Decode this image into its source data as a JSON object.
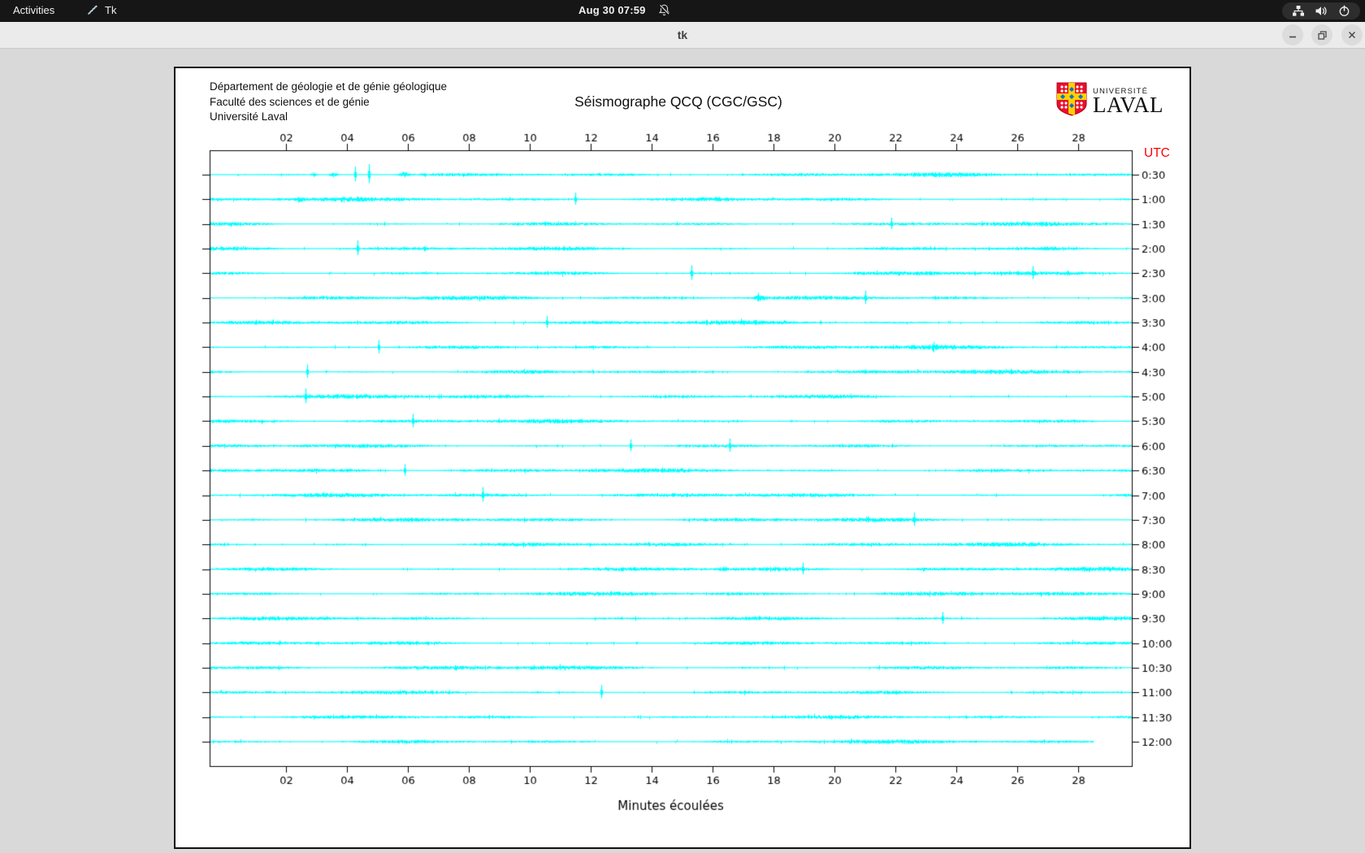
{
  "topbar": {
    "activities_label": "Activities",
    "app_label": "Tk",
    "clock": "Aug 30 07:59"
  },
  "titlebar": {
    "title": "tk"
  },
  "header": {
    "line1": "Département de géologie et de génie géologique",
    "line2": "Faculté des sciences et de génie",
    "line3": "Université Laval"
  },
  "logo": {
    "small": "UNIVERSITÉ",
    "large": "LAVAL"
  },
  "chart_data": {
    "type": "line",
    "title": "Séismographe QCQ (CGC/GSC)",
    "xlabel": "Minutes écoulées",
    "right_axis_label": "UTC",
    "right_axis_color": "#fb0007",
    "trace_color": "#00ffff",
    "x_ticks": [
      "02",
      "04",
      "06",
      "08",
      "10",
      "12",
      "14",
      "16",
      "18",
      "20",
      "22",
      "24",
      "26",
      "28"
    ],
    "x_tick_minutes": [
      2,
      4,
      6,
      8,
      10,
      12,
      14,
      16,
      18,
      20,
      22,
      24,
      26,
      28
    ],
    "x_range_minutes": [
      -0.5,
      29.76
    ],
    "rows": [
      {
        "label": "0:30",
        "spikes": [
          {
            "m": 4.27,
            "a": 10
          },
          {
            "m": 4.72,
            "a": 13
          }
        ],
        "bursts": [
          {
            "m": 2.9,
            "w": 0.3,
            "a": 2.5
          },
          {
            "m": 3.55,
            "w": 0.45,
            "a": 3
          },
          {
            "m": 5.85,
            "w": 0.45,
            "a": 3.2
          }
        ]
      },
      {
        "label": "1:00",
        "spikes": [
          {
            "m": 11.5,
            "a": 8
          }
        ],
        "bursts": [
          {
            "m": 2.45,
            "w": 0.35,
            "a": 3
          },
          {
            "m": 16.15,
            "w": 0.3,
            "a": 2.5
          }
        ]
      },
      {
        "label": "1:30",
        "spikes": [
          {
            "m": 21.87,
            "a": 8
          }
        ],
        "bursts": []
      },
      {
        "label": "2:00",
        "spikes": [
          {
            "m": 4.35,
            "a": 10
          }
        ],
        "bursts": []
      },
      {
        "label": "2:30",
        "spikes": [
          {
            "m": 15.3,
            "a": 10
          },
          {
            "m": 26.5,
            "a": 9
          }
        ],
        "bursts": []
      },
      {
        "label": "3:00",
        "spikes": [
          {
            "m": 21.0,
            "a": 9
          }
        ],
        "bursts": [
          {
            "m": 17.55,
            "w": 0.55,
            "a": 4
          }
        ]
      },
      {
        "label": "3:30",
        "spikes": [
          {
            "m": 10.56,
            "a": 8
          }
        ],
        "bursts": []
      },
      {
        "label": "4:00",
        "spikes": [
          {
            "m": 5.05,
            "a": 9
          }
        ],
        "bursts": [
          {
            "m": 23.25,
            "w": 0.35,
            "a": 4
          }
        ]
      },
      {
        "label": "4:30",
        "spikes": [
          {
            "m": 2.7,
            "a": 9
          }
        ],
        "bursts": []
      },
      {
        "label": "5:00",
        "spikes": [
          {
            "m": 2.65,
            "a": 10
          }
        ],
        "bursts": []
      },
      {
        "label": "5:30",
        "spikes": [
          {
            "m": 6.16,
            "a": 9
          }
        ],
        "bursts": []
      },
      {
        "label": "6:00",
        "spikes": [
          {
            "m": 13.3,
            "a": 8
          },
          {
            "m": 16.56,
            "a": 9
          }
        ],
        "bursts": []
      },
      {
        "label": "6:30",
        "spikes": [
          {
            "m": 5.89,
            "a": 8
          }
        ],
        "bursts": []
      },
      {
        "label": "7:00",
        "spikes": [
          {
            "m": 8.45,
            "a": 10
          }
        ],
        "bursts": []
      },
      {
        "label": "7:30",
        "spikes": [
          {
            "m": 22.6,
            "a": 9
          }
        ],
        "bursts": []
      },
      {
        "label": "8:00",
        "spikes": [],
        "bursts": []
      },
      {
        "label": "8:30",
        "spikes": [
          {
            "m": 18.95,
            "a": 8
          }
        ],
        "bursts": [
          {
            "m": 16.4,
            "w": 0.25,
            "a": 2.5
          },
          {
            "m": 22.9,
            "w": 0.2,
            "a": 2
          }
        ]
      },
      {
        "label": "9:00",
        "spikes": [],
        "bursts": []
      },
      {
        "label": "9:30",
        "spikes": [
          {
            "m": 23.55,
            "a": 8
          }
        ],
        "bursts": []
      },
      {
        "label": "10:00",
        "spikes": [],
        "bursts": []
      },
      {
        "label": "10:30",
        "spikes": [],
        "bursts": []
      },
      {
        "label": "11:00",
        "spikes": [
          {
            "m": 12.35,
            "a": 9
          }
        ],
        "bursts": []
      },
      {
        "label": "11:30",
        "spikes": [],
        "bursts": []
      },
      {
        "label": "12:00",
        "spikes": [],
        "bursts": [],
        "end_minute": 28.5
      }
    ]
  }
}
